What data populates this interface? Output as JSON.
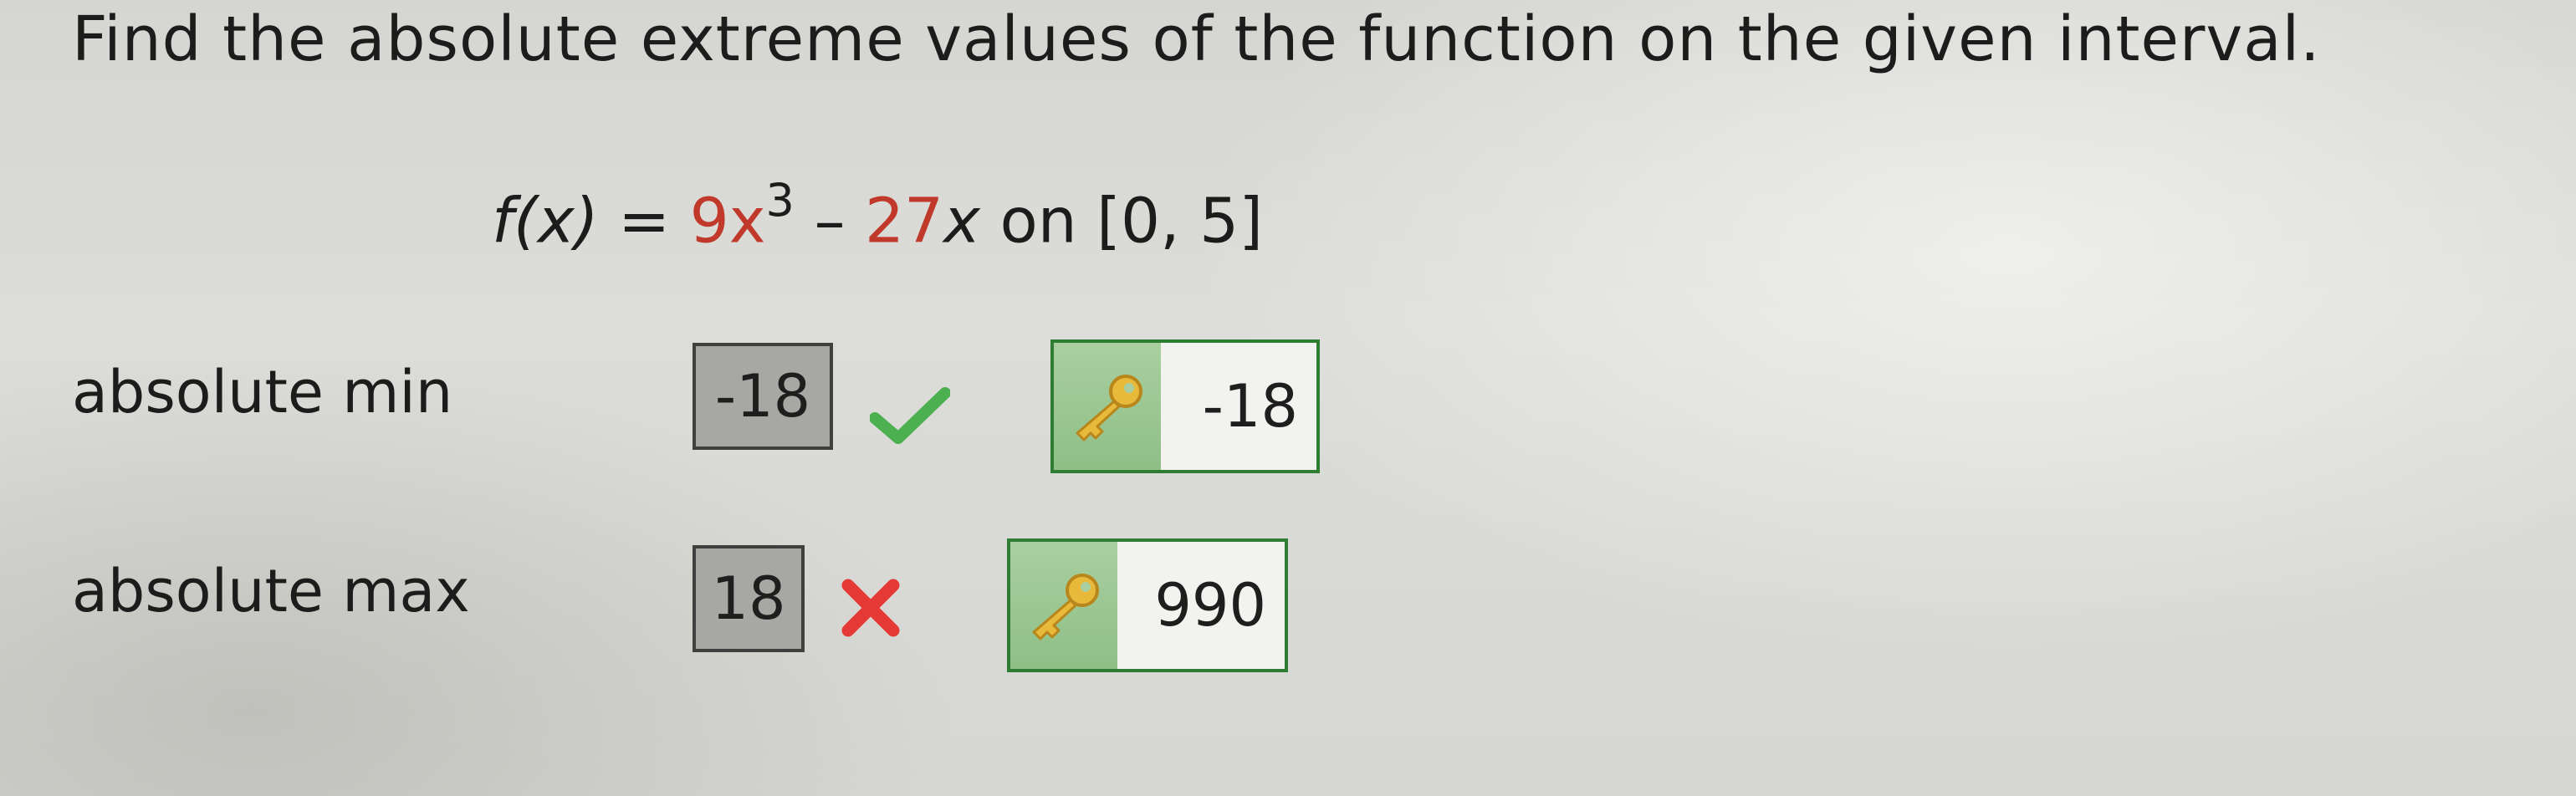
{
  "question": {
    "text": "Find the absolute extreme values of the function on the given interval."
  },
  "function": {
    "lhs": "f(x)",
    "equals": "=",
    "coef1": "9x",
    "exponent": "3",
    "minus": "–",
    "term2_coef": "27",
    "term2_var": "x",
    "interval": "on [0, 5]"
  },
  "rows": [
    {
      "label": "absolute min",
      "answer": "-18",
      "status": "correct",
      "status_icon": "checkmark-icon",
      "key_answer": "-18"
    },
    {
      "label": "absolute max",
      "answer": "18",
      "status": "incorrect",
      "status_icon": "cross-icon",
      "key_answer": "990"
    }
  ],
  "colors": {
    "correct": "#4caf50",
    "incorrect": "#e53935",
    "key_border": "#2e7d32",
    "coefficient": "#c0392b"
  },
  "icons": {
    "key": "key-icon"
  }
}
